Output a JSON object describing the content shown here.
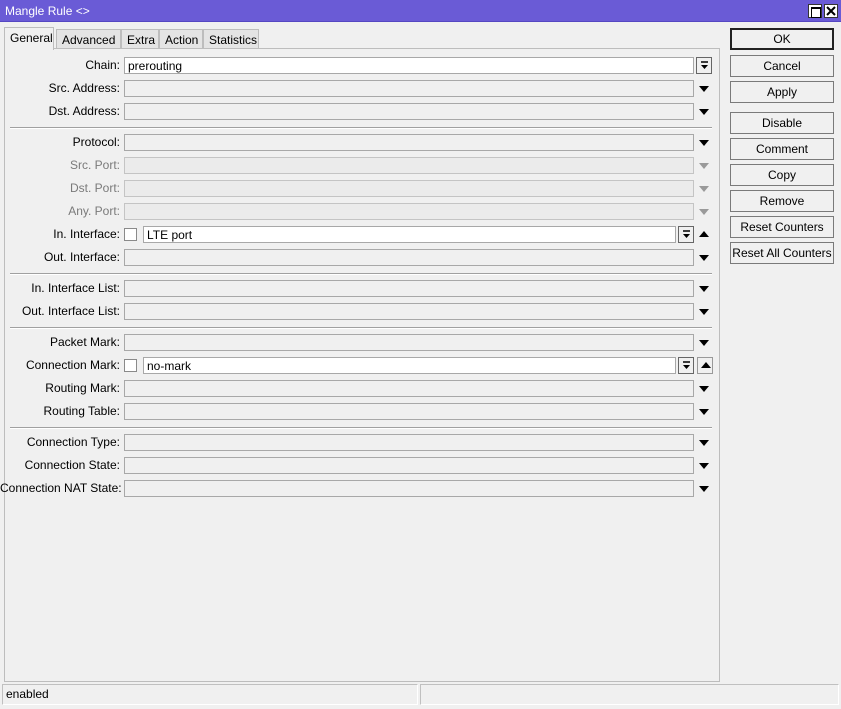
{
  "window": {
    "title": "Mangle Rule <>",
    "title_bar_color": "#6a5bd6",
    "icons": [
      "maximize-icon",
      "close-icon"
    ]
  },
  "tabs": [
    {
      "label": "General",
      "active": true
    },
    {
      "label": "Advanced",
      "active": false
    },
    {
      "label": "Extra",
      "active": false
    },
    {
      "label": "Action",
      "active": false
    },
    {
      "label": "Statistics",
      "active": false
    }
  ],
  "form": {
    "chain": {
      "label": "Chain:",
      "value": "prerouting"
    },
    "src_address": {
      "label": "Src. Address:",
      "value": ""
    },
    "dst_address": {
      "label": "Dst. Address:",
      "value": ""
    },
    "protocol": {
      "label": "Protocol:",
      "value": ""
    },
    "src_port": {
      "label": "Src. Port:",
      "value": "",
      "disabled": true
    },
    "dst_port": {
      "label": "Dst. Port:",
      "value": "",
      "disabled": true
    },
    "any_port": {
      "label": "Any. Port:",
      "value": "",
      "disabled": true
    },
    "in_interface": {
      "label": "In. Interface:",
      "value": "LTE port",
      "negate": false
    },
    "out_interface": {
      "label": "Out. Interface:",
      "value": ""
    },
    "in_interface_list": {
      "label": "In. Interface List:",
      "value": ""
    },
    "out_interface_list": {
      "label": "Out. Interface List:",
      "value": ""
    },
    "packet_mark": {
      "label": "Packet Mark:",
      "value": ""
    },
    "connection_mark": {
      "label": "Connection Mark:",
      "value": "no-mark",
      "negate": false
    },
    "routing_mark": {
      "label": "Routing Mark:",
      "value": ""
    },
    "routing_table": {
      "label": "Routing Table:",
      "value": ""
    },
    "connection_type": {
      "label": "Connection Type:",
      "value": ""
    },
    "connection_state": {
      "label": "Connection State:",
      "value": ""
    },
    "connection_nat_state": {
      "label": "Connection NAT State:",
      "value": ""
    }
  },
  "buttons": {
    "ok": "OK",
    "cancel": "Cancel",
    "apply": "Apply",
    "disable": "Disable",
    "comment": "Comment",
    "copy": "Copy",
    "remove": "Remove",
    "reset_counters": "Reset Counters",
    "reset_all_counters": "Reset All Counters"
  },
  "status": {
    "text": "enabled"
  }
}
